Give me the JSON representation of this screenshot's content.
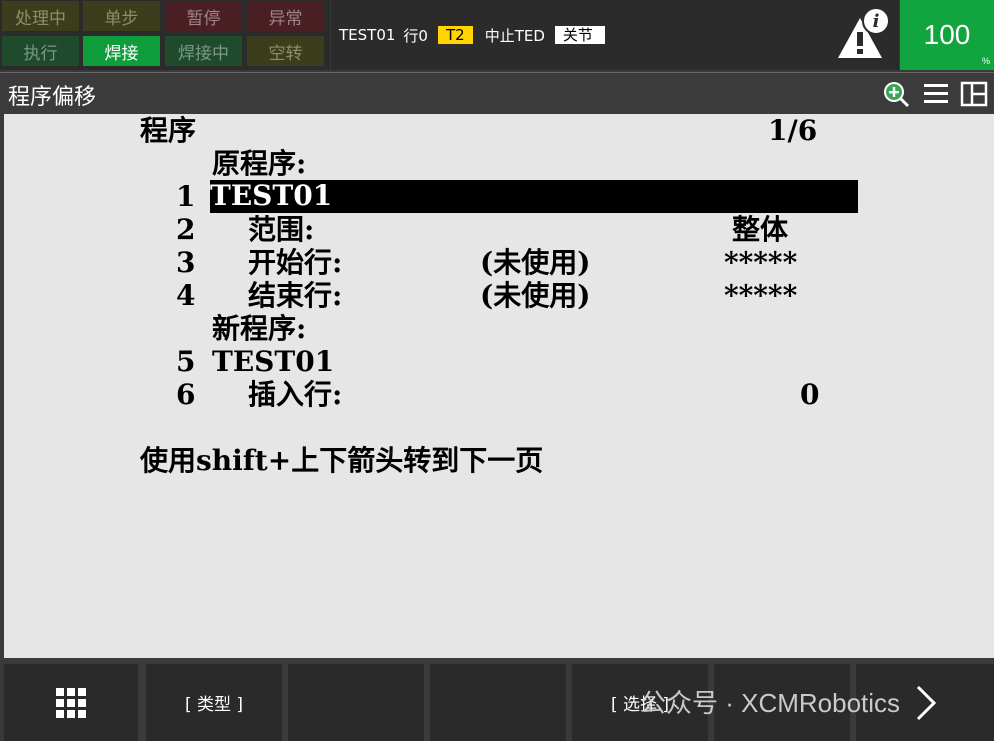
{
  "status": {
    "row1": [
      "处理中",
      "单步",
      "暂停",
      "异常"
    ],
    "row2": [
      "执行",
      "焊接",
      "焊接中",
      "空转"
    ]
  },
  "info": {
    "program": "TEST01",
    "line": "行0",
    "mode": "T2",
    "state": "中止TED",
    "joint": "关节"
  },
  "override": {
    "value": "100",
    "unit": "%"
  },
  "title": "程序偏移",
  "content": {
    "section_label": "程序",
    "page": "1/6",
    "original_label": "原程序:",
    "new_label": "新程序:",
    "rows": [
      {
        "num": "1",
        "label": "TEST01",
        "value": "",
        "right": ""
      },
      {
        "num": "2",
        "label": "范围:",
        "value": "",
        "right": "整体"
      },
      {
        "num": "3",
        "label": "开始行:",
        "value": "(未使用)",
        "right": "*****"
      },
      {
        "num": "4",
        "label": "结束行:",
        "value": "(未使用)",
        "right": "*****"
      },
      {
        "num": "5",
        "label": "TEST01",
        "value": "",
        "right": ""
      },
      {
        "num": "6",
        "label": "插入行:",
        "value": "",
        "right": "0"
      }
    ],
    "hint": "使用shift+上下箭头转到下一页"
  },
  "fkeys": {
    "f1_icon": "grid-icon",
    "f2": "[ 类型 ]",
    "f5": "[ 选择 ]",
    "next_icon": "chevron-right-icon"
  },
  "watermark": "公众号 · XCMRobotics",
  "colors": {
    "green_on": "#0f9d3b",
    "yellow_chip": "#ffd400",
    "override_bg": "#11a53f"
  }
}
